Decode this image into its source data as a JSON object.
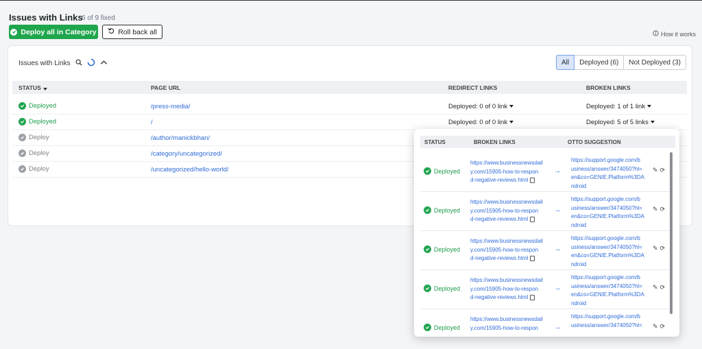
{
  "header": {
    "title": "Issues with Links",
    "count": "6 of 9 fixed"
  },
  "actions": {
    "deploy_all": "Deploy all in Category",
    "rollback_all": "Roll back all",
    "how_it_works": "How it works"
  },
  "card": {
    "title": "Issues with Links"
  },
  "filters": [
    {
      "label": "All"
    },
    {
      "label": "Deployed (6)"
    },
    {
      "label": "Not Deployed (3)"
    }
  ],
  "table": {
    "columns": [
      "STATUS",
      "PAGE URL",
      "REDIRECT LINKS",
      "BROKEN LINKS"
    ],
    "rows": [
      {
        "status": "Deployed",
        "url": "/press-media/",
        "redirect": "Deployed: 0 of 0 link",
        "broken": "Deployed: 1 of 1 link"
      },
      {
        "status": "Deployed",
        "url": "/",
        "redirect": "Deployed: 0 of 0 link",
        "broken": "Deployed: 5 of 5 links"
      },
      {
        "status": "Deploy",
        "url": "/author/manickbhan/",
        "redirect": "",
        "broken": ""
      },
      {
        "status": "Deploy",
        "url": "/category/uncategorized/",
        "redirect": "",
        "broken": ""
      },
      {
        "status": "Deploy",
        "url": "/uncategorized/hello-world/",
        "redirect": "",
        "broken": ""
      }
    ]
  },
  "popup": {
    "columns": [
      "STATUS",
      "BROKEN LINKS",
      "OTTO SUGGESTION"
    ],
    "rows": [
      {
        "status": "Deployed",
        "l1": "https://www.businessnewsdail",
        "l2": "y.com/15905-how-to-respon",
        "l3": "d-negative-reviews.html",
        "s1": "https://support.google.com/b",
        "s2": "usiness/answer/3474050?hl=",
        "s3": "en&co=GENIE.Platform%3DA",
        "s4": "ndroid"
      },
      {
        "status": "Deployed",
        "l1": "https://www.businessnewsdail",
        "l2": "y.com/15905-how-to-respon",
        "l3": "d-negative-reviews.html",
        "s1": "https://support.google.com/b",
        "s2": "usiness/answer/3474050?hl=",
        "s3": "en&co=GENIE.Platform%3DA",
        "s4": "ndroid"
      },
      {
        "status": "Deployed",
        "l1": "https://www.businessnewsdail",
        "l2": "y.com/15905-how-to-respon",
        "l3": "d-negative-reviews.html",
        "s1": "https://support.google.com/b",
        "s2": "usiness/answer/3474050?hl=",
        "s3": "en&co=GENIE.Platform%3DA",
        "s4": "ndroid"
      },
      {
        "status": "Deployed",
        "l1": "https://www.businessnewsdail",
        "l2": "y.com/15905-how-to-respon",
        "l3": "d-negative-reviews.html",
        "s1": "https://support.google.com/b",
        "s2": "usiness/answer/3474050?hl=",
        "s3": "en&co=GENIE.Platform%3DA",
        "s4": "ndroid"
      },
      {
        "status": "Deployed",
        "l1": "https://www.businessnewsdail",
        "l2": "y.com/15905-how-to-respon",
        "l3": "",
        "s1": "https://support.google.com/b",
        "s2": "usiness/answer/3474050?hl=",
        "s3": "",
        "s4": ""
      }
    ]
  },
  "colors": {
    "accent_green": "#1fa64d",
    "link_blue": "#2f6bd8",
    "filter_active": "#dbe6fb"
  }
}
